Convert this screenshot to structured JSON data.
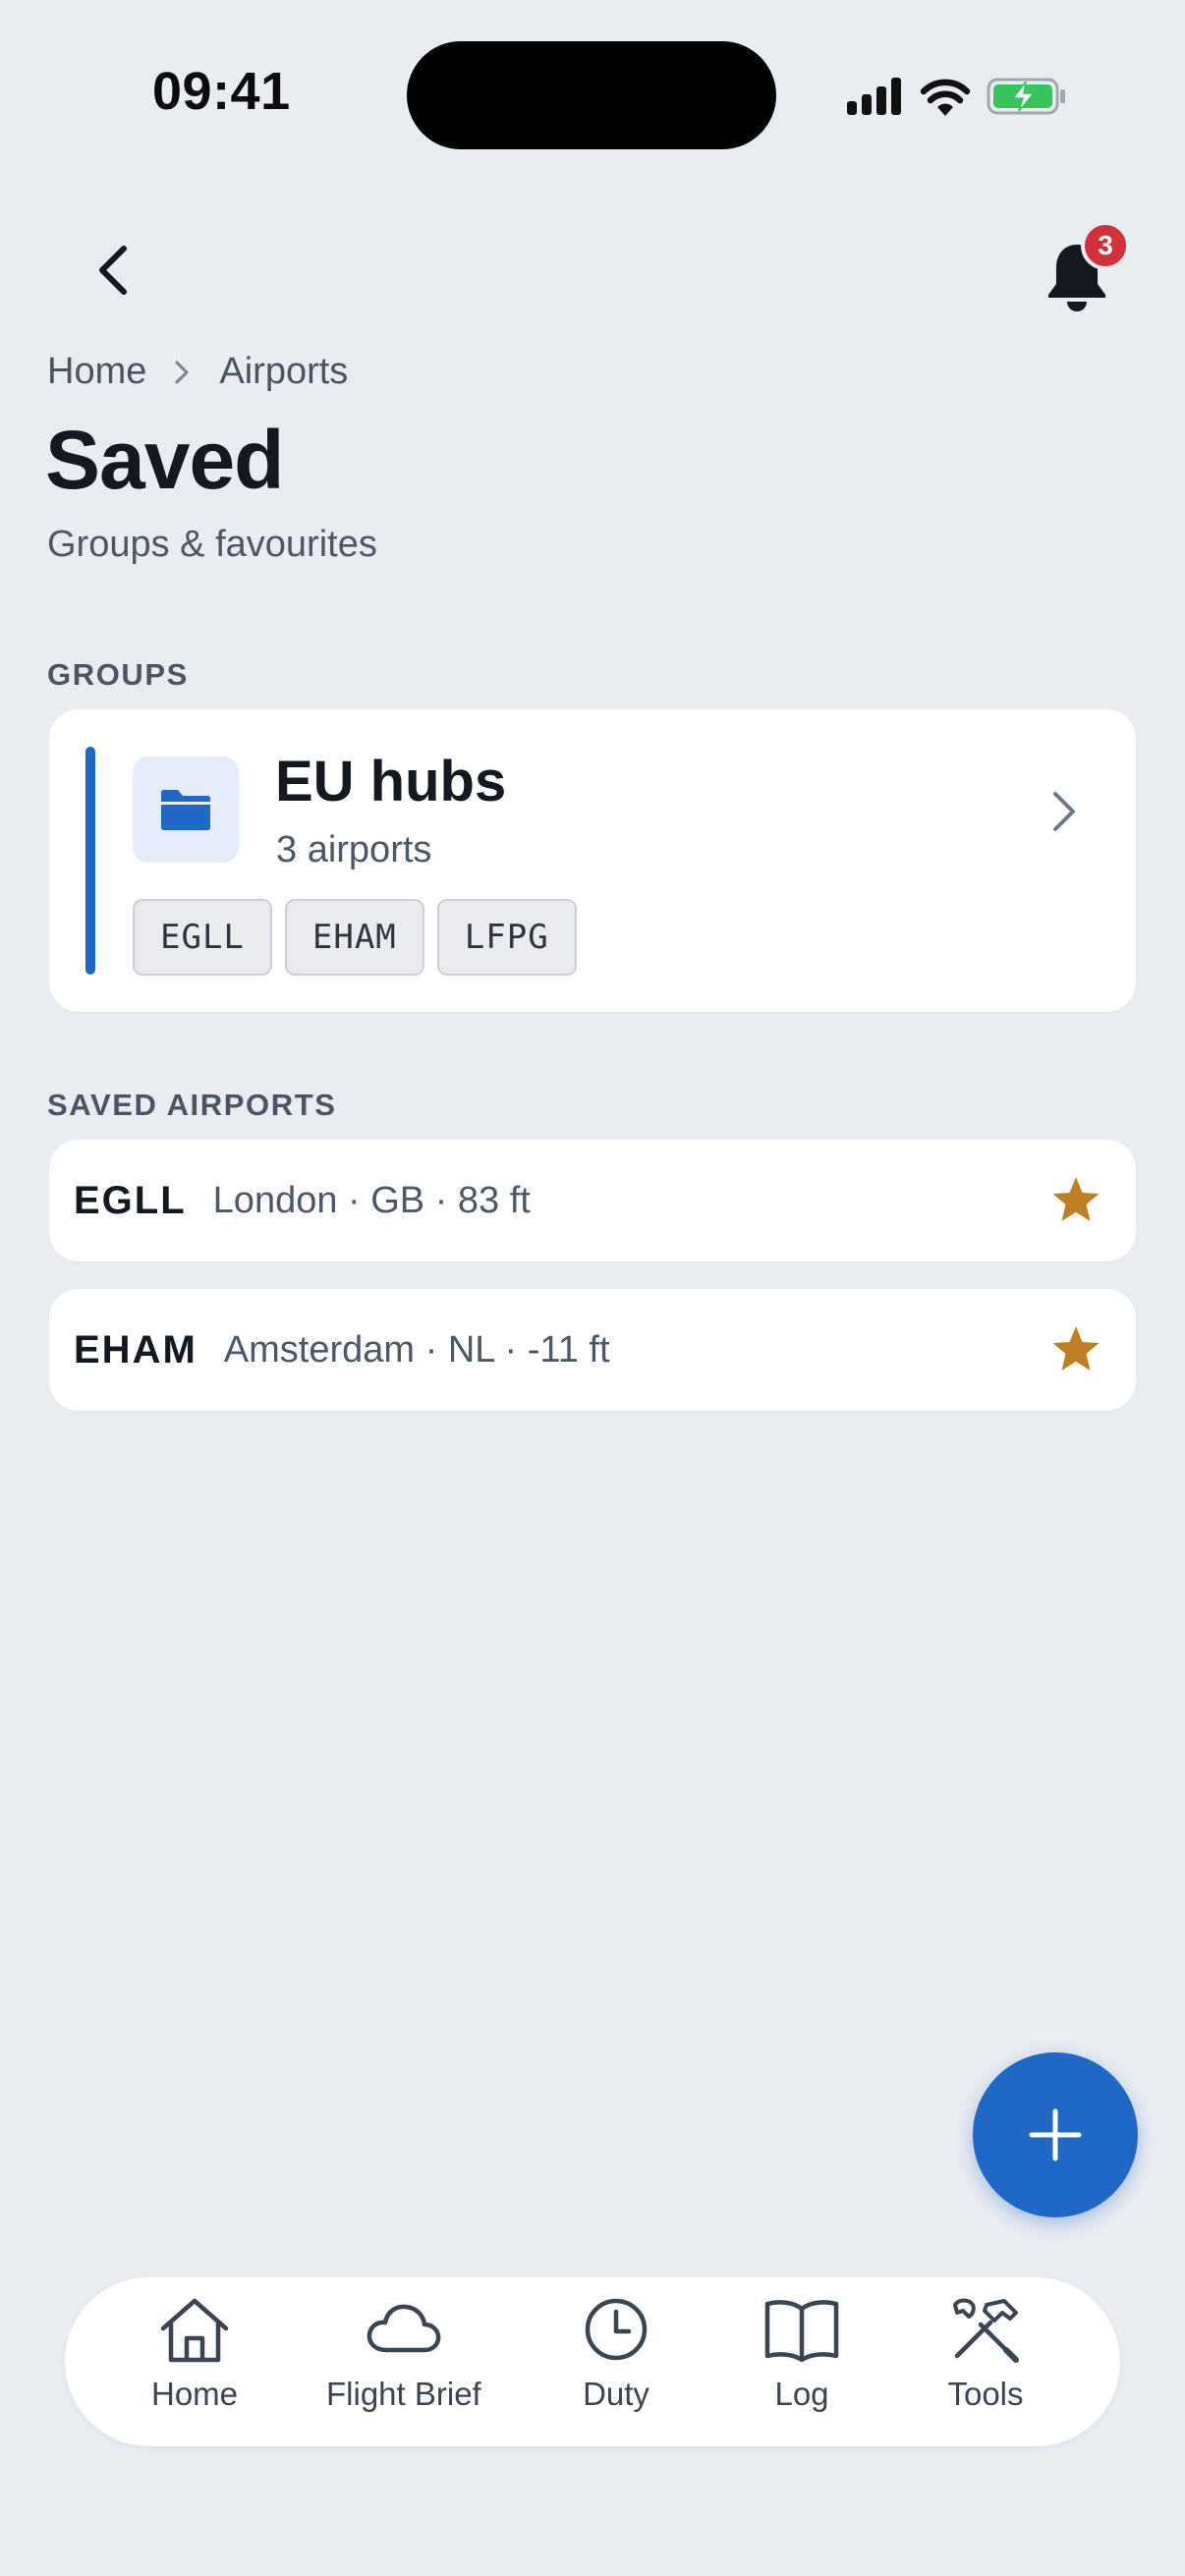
{
  "status_bar": {
    "time": "09:41"
  },
  "header": {
    "notification_count": "3"
  },
  "breadcrumb": {
    "items": [
      "Home",
      "Airports"
    ]
  },
  "page": {
    "title": "Saved",
    "subtitle": "Groups & favourites"
  },
  "groups_section": {
    "label": "GROUPS",
    "groups": [
      {
        "name": "EU hubs",
        "count": "3 airports",
        "codes": [
          "EGLL",
          "EHAM",
          "LFPG"
        ],
        "accent_color": "#1f68c6"
      }
    ]
  },
  "airports_section": {
    "label": "SAVED AIRPORTS",
    "airports": [
      {
        "code": "EGLL",
        "meta": "London · GB · 83 ft",
        "favourite": true
      },
      {
        "code": "EHAM",
        "meta": "Amsterdam · NL · -11 ft",
        "favourite": true
      }
    ]
  },
  "bottom_nav": {
    "items": [
      {
        "label": "Home",
        "icon": "home-icon"
      },
      {
        "label": "Flight Brief",
        "icon": "cloud-icon"
      },
      {
        "label": "Duty",
        "icon": "clock-icon"
      },
      {
        "label": "Log",
        "icon": "book-icon"
      },
      {
        "label": "Tools",
        "icon": "tools-icon"
      }
    ]
  },
  "colors": {
    "accent": "#1f68c6",
    "star": "#c07f22",
    "badge": "#d2313c",
    "background": "#e9ecf1"
  }
}
